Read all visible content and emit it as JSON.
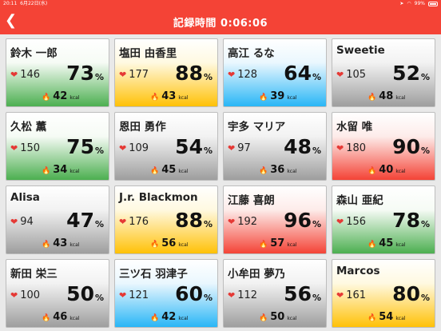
{
  "status_bar": {
    "time": "20:11",
    "date": "6月22日(水)",
    "battery": "99%",
    "icons": [
      "location-icon",
      "wifi-icon",
      "battery-icon"
    ]
  },
  "header": {
    "back_icon": "chevron-left-icon",
    "title": "記録時間 0:06:06",
    "bg_color": "#f44336"
  },
  "colors": {
    "green": "#4caf50",
    "yellow": "#ffc107",
    "blue": "#29b6f6",
    "gray": "#9e9e9e",
    "red": "#f44336",
    "heart": "#e53935"
  },
  "units": {
    "percent": "%",
    "kcal": "kcal"
  },
  "cards": [
    {
      "name": "鈴木 一郎",
      "heart_rate": "146",
      "percent": "73",
      "kcal": "42",
      "color": "green"
    },
    {
      "name": "塩田 由香里",
      "heart_rate": "177",
      "percent": "88",
      "kcal": "43",
      "color": "yellow"
    },
    {
      "name": "高江 るな",
      "heart_rate": "128",
      "percent": "64",
      "kcal": "39",
      "color": "blue"
    },
    {
      "name": "Sweetie",
      "heart_rate": "105",
      "percent": "52",
      "kcal": "48",
      "color": "gray"
    },
    {
      "name": "久松 薫",
      "heart_rate": "150",
      "percent": "75",
      "kcal": "34",
      "color": "green"
    },
    {
      "name": "恩田 勇作",
      "heart_rate": "109",
      "percent": "54",
      "kcal": "45",
      "color": "gray"
    },
    {
      "name": "宇多 マリア",
      "heart_rate": "97",
      "percent": "48",
      "kcal": "36",
      "color": "gray"
    },
    {
      "name": "水留 唯",
      "heart_rate": "180",
      "percent": "90",
      "kcal": "40",
      "color": "red"
    },
    {
      "name": "Alisa",
      "heart_rate": "94",
      "percent": "47",
      "kcal": "43",
      "color": "gray"
    },
    {
      "name": "J.r. Blackmon",
      "heart_rate": "176",
      "percent": "88",
      "kcal": "56",
      "color": "yellow"
    },
    {
      "name": "江藤 喜朗",
      "heart_rate": "192",
      "percent": "96",
      "kcal": "57",
      "color": "red"
    },
    {
      "name": "森山 亜紀",
      "heart_rate": "156",
      "percent": "78",
      "kcal": "45",
      "color": "green"
    },
    {
      "name": "新田 栄三",
      "heart_rate": "100",
      "percent": "50",
      "kcal": "46",
      "color": "gray"
    },
    {
      "name": "三ツ石 羽津子",
      "heart_rate": "121",
      "percent": "60",
      "kcal": "42",
      "color": "blue"
    },
    {
      "name": "小牟田 夢乃",
      "heart_rate": "112",
      "percent": "56",
      "kcal": "50",
      "color": "gray"
    },
    {
      "name": "Marcos",
      "heart_rate": "161",
      "percent": "80",
      "kcal": "54",
      "color": "yellow"
    }
  ]
}
